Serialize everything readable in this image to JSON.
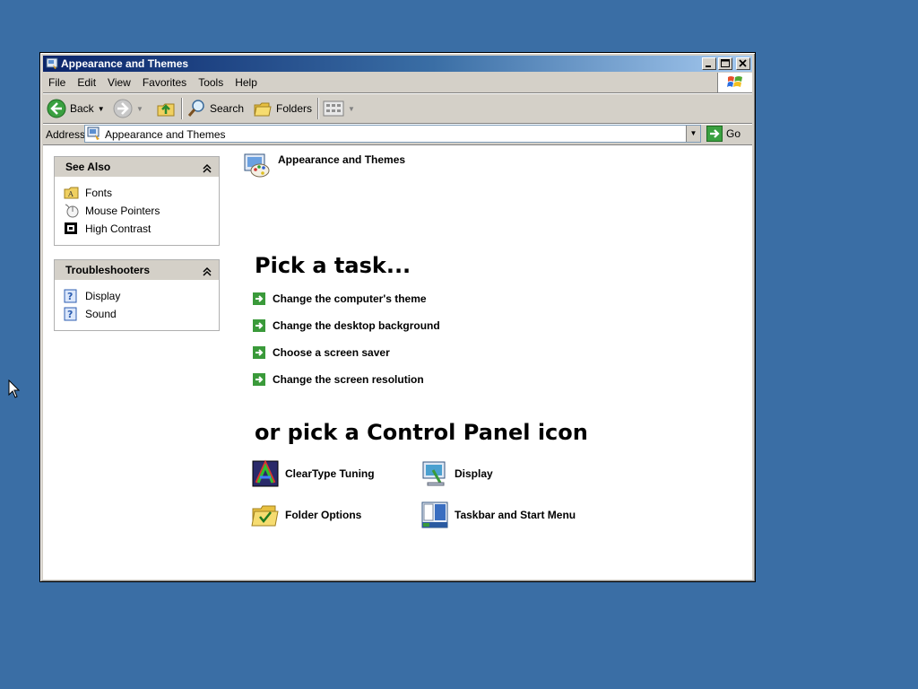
{
  "window": {
    "title": "Appearance and Themes"
  },
  "menu": {
    "items": [
      "File",
      "Edit",
      "View",
      "Favorites",
      "Tools",
      "Help"
    ]
  },
  "toolbar": {
    "back_label": "Back",
    "search_label": "Search",
    "folders_label": "Folders"
  },
  "address": {
    "label": "Address",
    "value": "Appearance and Themes",
    "go_label": "Go"
  },
  "see_also": {
    "title": "See Also",
    "items": [
      {
        "label": "Fonts",
        "icon": "fonts-folder-icon"
      },
      {
        "label": "Mouse Pointers",
        "icon": "mouse-icon"
      },
      {
        "label": "High Contrast",
        "icon": "high-contrast-icon"
      }
    ]
  },
  "troubleshooters": {
    "title": "Troubleshooters",
    "items": [
      {
        "label": "Display",
        "icon": "help-icon"
      },
      {
        "label": "Sound",
        "icon": "help-icon"
      }
    ]
  },
  "main": {
    "header": "Appearance and Themes",
    "task_heading": "Pick a task...",
    "tasks": [
      "Change the computer's theme",
      "Change the desktop background",
      "Choose a screen saver",
      "Change the screen resolution"
    ],
    "icon_heading": "or pick a Control Panel icon",
    "icons": [
      {
        "label": "ClearType Tuning",
        "icon": "cleartype-icon"
      },
      {
        "label": "Display",
        "icon": "display-icon"
      },
      {
        "label": "Folder Options",
        "icon": "folder-options-icon"
      },
      {
        "label": "Taskbar and Start Menu",
        "icon": "taskbar-icon"
      }
    ]
  },
  "colors": {
    "desktop": "#3a6ea5",
    "titlebar_start": "#0a246a",
    "titlebar_end": "#a6caf0",
    "task_arrow": "#3a9a3a"
  }
}
